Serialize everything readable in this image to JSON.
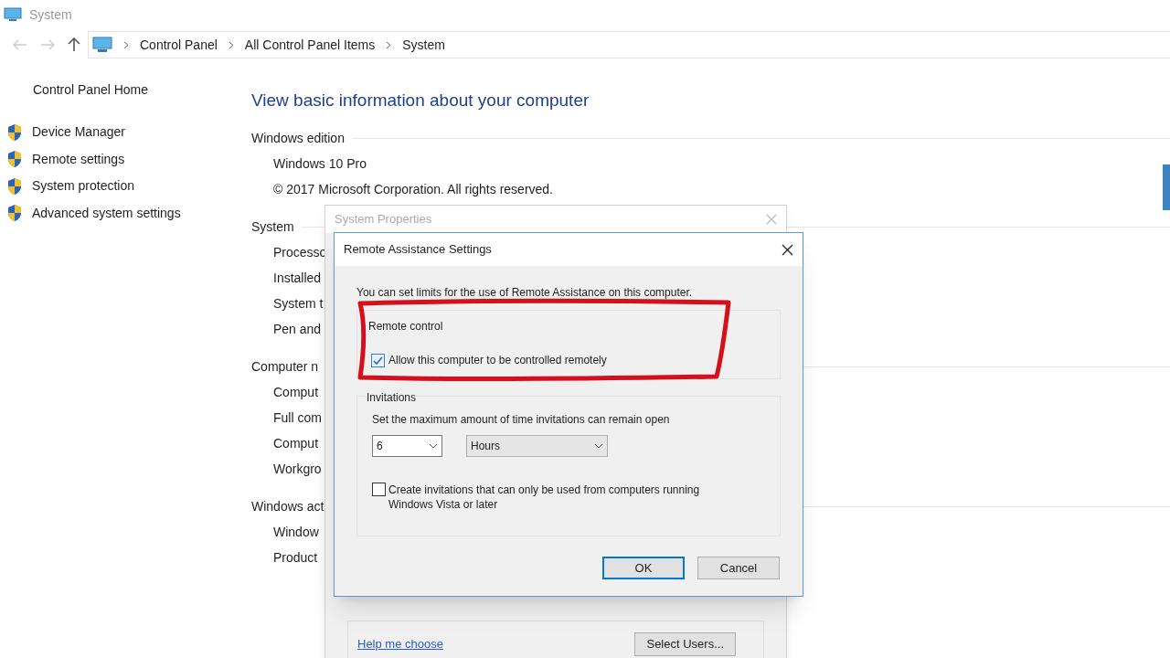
{
  "window": {
    "title": "System"
  },
  "breadcrumb": [
    "Control Panel",
    "All Control Panel Items",
    "System"
  ],
  "sidebar": {
    "home": "Control Panel Home",
    "items": [
      {
        "label": "Device Manager"
      },
      {
        "label": "Remote settings"
      },
      {
        "label": "System protection"
      },
      {
        "label": "Advanced system settings"
      }
    ]
  },
  "heading": "View basic information about your computer",
  "sections": [
    {
      "title": "Windows edition",
      "lines": [
        "Windows 10 Pro",
        "© 2017 Microsoft Corporation. All rights reserved."
      ]
    },
    {
      "title": "System",
      "lines": [
        "Processo",
        "Installed",
        "System t",
        "Pen and"
      ]
    },
    {
      "title": "Computer n",
      "lines": [
        "Comput",
        "Full com",
        "Comput",
        "Workgro"
      ]
    },
    {
      "title": "Windows act",
      "lines": [
        "Window",
        "Product"
      ]
    }
  ],
  "system_properties": {
    "title": "System Properties",
    "link": "Help me choose",
    "button": "Select Users..."
  },
  "dialog": {
    "title": "Remote Assistance Settings",
    "intro": "You can set limits for the use of Remote Assistance on this computer.",
    "remote_control": {
      "title": "Remote control",
      "checkbox": {
        "label": "Allow this computer to be controlled remotely",
        "checked": true
      }
    },
    "invitations": {
      "title": "Invitations",
      "prompt": "Set the maximum amount of time invitations can remain open",
      "amount": "6",
      "unit": "Hours",
      "checkbox": {
        "label": "Create invitations that can only be used from computers running Windows Vista or later",
        "checked": false
      }
    },
    "buttons": [
      {
        "label": "OK",
        "selected": true
      },
      {
        "label": "Cancel",
        "selected": false
      }
    ]
  }
}
